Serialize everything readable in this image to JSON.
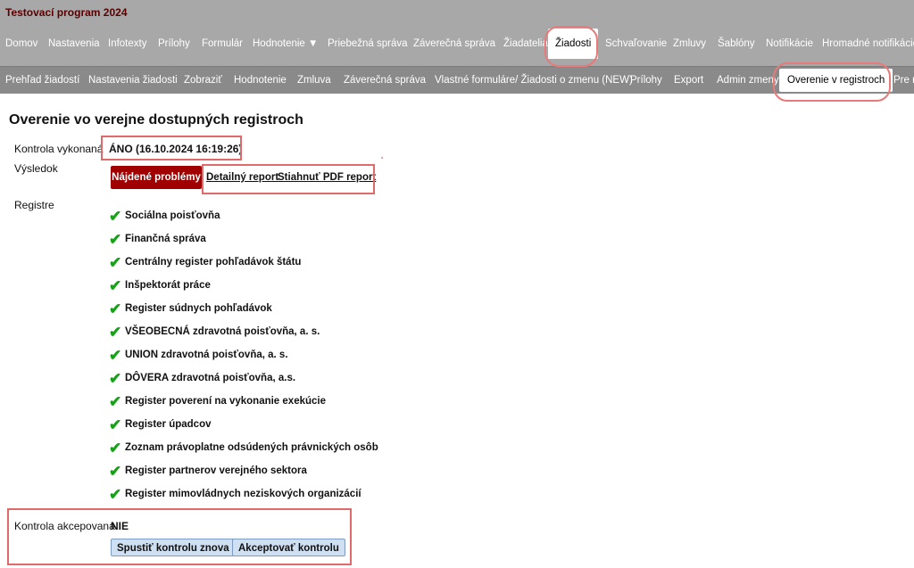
{
  "app": {
    "title": "Testovací program 2024"
  },
  "main_nav": {
    "items": [
      {
        "label": "Domov"
      },
      {
        "label": "Nastavenia"
      },
      {
        "label": "Infotexty"
      },
      {
        "label": "Prílohy"
      },
      {
        "label": "Formulár"
      },
      {
        "label": "Hodnotenie ▼"
      },
      {
        "label": "Priebežná správa"
      },
      {
        "label": "Záverečná správa"
      },
      {
        "label": "Žiadatelia"
      },
      {
        "label": "Žiadosti"
      },
      {
        "label": "Schvaľovanie"
      },
      {
        "label": "Zmluvy"
      },
      {
        "label": "Šablóny"
      },
      {
        "label": "Notifikácie"
      },
      {
        "label": "Hromadné notifikácie"
      }
    ],
    "active": "Žiadosti"
  },
  "sub_nav": {
    "items": [
      {
        "label": "Prehľad žiadostí"
      },
      {
        "label": "Nastavenia žiadosti"
      },
      {
        "label": "Zobraziť"
      },
      {
        "label": "Hodnotenie"
      },
      {
        "label": "Zmluva"
      },
      {
        "label": "Záverečná správa"
      },
      {
        "label": "Vlastné formuláre/ Žiadosti o zmenu (NEW)"
      },
      {
        "label": "Prílohy"
      },
      {
        "label": "Export"
      },
      {
        "label": "Admin zmeny"
      },
      {
        "label": "Overenie v registroch"
      },
      {
        "label": "Pre r"
      }
    ],
    "active": "Overenie v registroch"
  },
  "page": {
    "title": "Overenie vo verejne dostupných registroch",
    "check_done_label": "Kontrola vykonaná",
    "check_done_value": "ÁNO (16.10.2024 16:19:26)",
    "result_label": "Výsledok",
    "result_badge": "Nájdené problémy",
    "detail_report_link": "Detailný report",
    "pdf_report_link": "Stiahnuť PDF report",
    "registers_label": "Registre",
    "registers": [
      "Sociálna poisťovňa",
      "Finančná správa",
      "Centrálny register pohľadávok štátu",
      "Inšpektorát práce",
      "Register súdnych pohľadávok",
      "VŠEOBECNÁ zdravotná poisťovňa, a. s.",
      "UNION zdravotná poisťovňa, a. s.",
      "DÔVERA zdravotná poisťovňa, a.s.",
      "Register poverení na vykonanie exekúcie",
      "Register úpadcov",
      "Zoznam právoplatne odsúdených právnických osôb",
      "Register partnerov verejného sektora",
      "Register mimovládnych neziskových organizácií"
    ],
    "check_icon": "✔",
    "accepted_label": "Kontrola akcepovaná",
    "accepted_value": "NIE",
    "rerun_button": "Spustiť kontrolu znova",
    "accept_button": "Akceptovať kontrolu"
  },
  "colors": {
    "topbar": "#a8a8a8",
    "subbar": "#8a8a8a",
    "badge": "#a00000",
    "check": "#18a018",
    "highlight": "#e06a6a",
    "button": "#cfe0f3"
  }
}
